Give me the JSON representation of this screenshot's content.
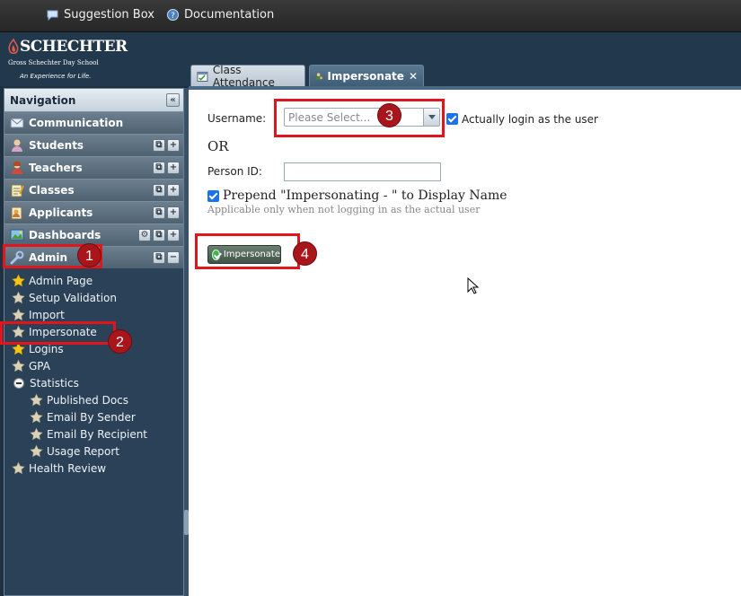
{
  "topbar": {
    "links": [
      {
        "label": "Suggestion Box",
        "icon": "speech-bubble-icon"
      },
      {
        "label": "Documentation",
        "icon": "help-icon"
      }
    ]
  },
  "logo": {
    "brand": "SCHECHTER",
    "subtitle": "Gross Schechter Day School",
    "tagline": "An Experience for Life."
  },
  "tabs": [
    {
      "label": "Class Attendance",
      "icon": "attendance-icon",
      "active": false
    },
    {
      "label": "Impersonate",
      "icon": "user-icon",
      "active": true
    }
  ],
  "nav": {
    "title": "Navigation",
    "sections": [
      {
        "label": "Communication",
        "icon": "envelope-icon"
      },
      {
        "label": "Students",
        "icon": "student-icon"
      },
      {
        "label": "Teachers",
        "icon": "teacher-icon"
      },
      {
        "label": "Classes",
        "icon": "classes-icon"
      },
      {
        "label": "Applicants",
        "icon": "applicants-icon"
      },
      {
        "label": "Dashboards",
        "icon": "dashboard-icon"
      },
      {
        "label": "Admin",
        "icon": "wrench-icon"
      }
    ],
    "admin_items": [
      {
        "label": "Admin Page"
      },
      {
        "label": "Setup Validation"
      },
      {
        "label": "Import"
      },
      {
        "label": "Impersonate"
      },
      {
        "label": "Logins"
      },
      {
        "label": "GPA"
      },
      {
        "label": "Statistics"
      },
      {
        "label": "Published Docs"
      },
      {
        "label": "Email By Sender"
      },
      {
        "label": "Email By Recipient"
      },
      {
        "label": "Usage Report"
      },
      {
        "label": "Health Review"
      }
    ]
  },
  "form": {
    "username_label": "Username:",
    "username_placeholder": "Please Select...",
    "actually_login_label": "Actually login as the user",
    "actually_login_checked": true,
    "or_text": "OR",
    "person_id_label": "Person ID:",
    "person_id_value": "",
    "prepend_label": "Prepend \"Impersonating - \" to Display Name",
    "prepend_checked": true,
    "hint": "Applicable only when not logging in as the actual user",
    "submit_label": "Impersonate"
  },
  "annotations": [
    "1",
    "2",
    "3",
    "4"
  ],
  "colors": {
    "highlight": "#e1161c",
    "badge": "#a8151a",
    "nav_bg": "#2b4157"
  }
}
